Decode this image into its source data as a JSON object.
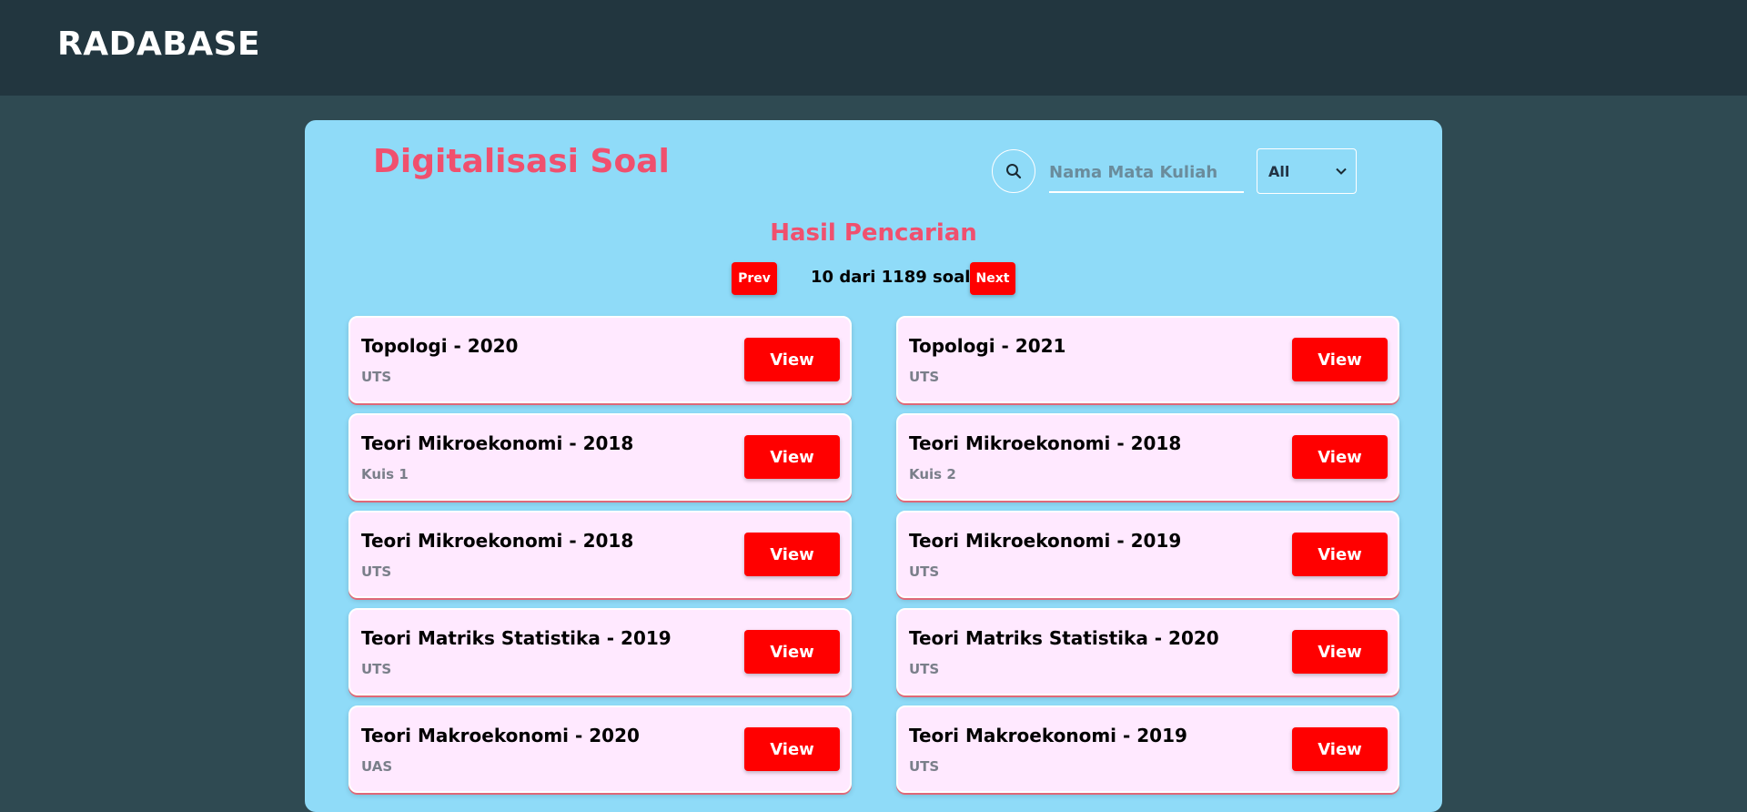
{
  "header": {
    "brand": "RADABASE"
  },
  "panel": {
    "title": "Digitalisasi Soal",
    "search": {
      "placeholder": "Nama Mata Kuliah",
      "icon": "search-icon"
    },
    "filter": {
      "selected": "All"
    },
    "results_title": "Hasil Pencarian",
    "pager": {
      "prev_label": "Prev",
      "info": "10 dari 1189 soal",
      "next_label": "Next"
    },
    "view_label": "View",
    "cards": [
      {
        "title": "Topologi - 2020",
        "type": "UTS"
      },
      {
        "title": "Topologi - 2021",
        "type": "UTS"
      },
      {
        "title": "Teori Mikroekonomi - 2018",
        "type": "Kuis 1"
      },
      {
        "title": "Teori Mikroekonomi - 2018",
        "type": "Kuis 2"
      },
      {
        "title": "Teori Mikroekonomi - 2018",
        "type": "UTS"
      },
      {
        "title": "Teori Mikroekonomi - 2019",
        "type": "UTS"
      },
      {
        "title": "Teori Matriks Statistika - 2019",
        "type": "UTS"
      },
      {
        "title": "Teori Matriks Statistika - 2020",
        "type": "UTS"
      },
      {
        "title": "Teori Makroekonomi - 2020",
        "type": "UAS"
      },
      {
        "title": "Teori Makroekonomi - 2019",
        "type": "UTS"
      }
    ]
  },
  "colors": {
    "header_bg": "#22363f",
    "page_bg": "#2f4a52",
    "panel_bg": "#8fdbf8",
    "accent_pink": "#f0506e",
    "button_red": "#ff0000",
    "card_bg": "#ffe9ff"
  }
}
